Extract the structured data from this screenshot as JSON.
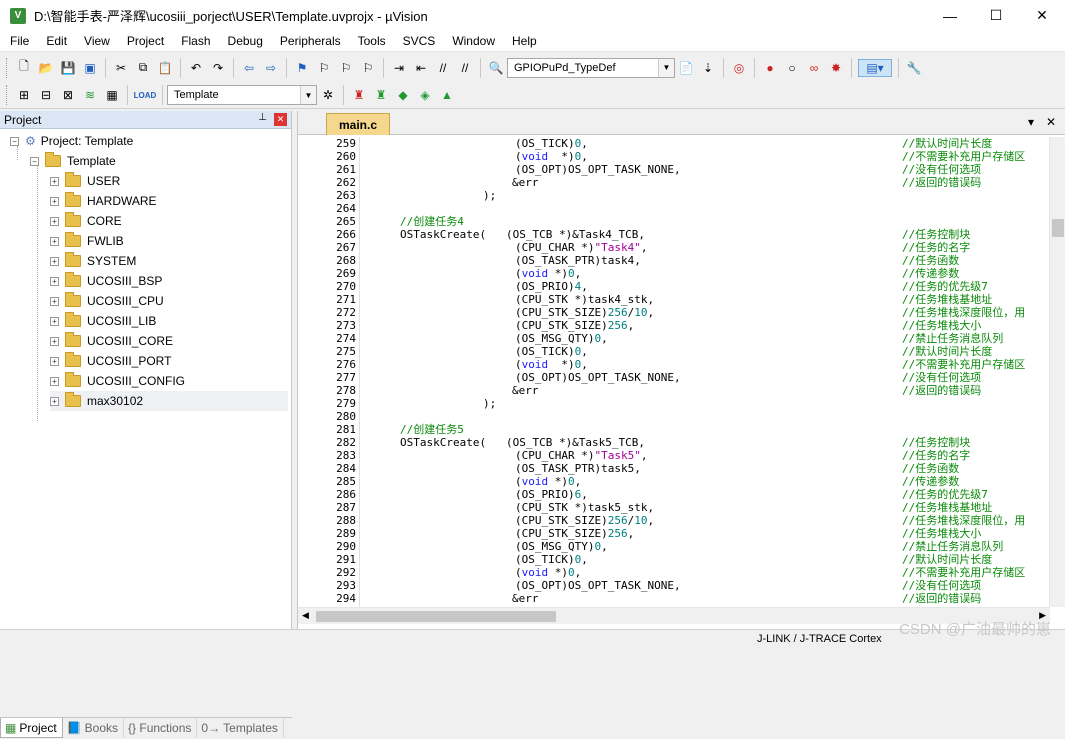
{
  "window": {
    "title": "D:\\智能手表-严泽辉\\ucosiii_porject\\USER\\Template.uvprojx - µVision",
    "app_icon": "V",
    "minimize": "—",
    "maximize": "☐",
    "close": "✕"
  },
  "menu": [
    "File",
    "Edit",
    "View",
    "Project",
    "Flash",
    "Debug",
    "Peripherals",
    "Tools",
    "SVCS",
    "Window",
    "Help"
  ],
  "toolbar1": {
    "find_combo_value": "GPIOPuPd_TypeDef"
  },
  "toolbar2": {
    "target_combo_value": "Template",
    "load_label": "LOAD"
  },
  "project_panel": {
    "title": "Project",
    "pin": "📌",
    "close": "✕",
    "root_label": "Project: Template",
    "target_label": "Template",
    "groups": [
      "USER",
      "HARDWARE",
      "CORE",
      "FWLIB",
      "SYSTEM",
      "UCOSIII_BSP",
      "UCOSIII_CPU",
      "UCOSIII_LIB",
      "UCOSIII_CORE",
      "UCOSIII_PORT",
      "UCOSIII_CONFIG",
      "max30102"
    ],
    "tabs": [
      "Project",
      "Books",
      "{} Functions",
      "0→ Templates"
    ]
  },
  "editor": {
    "file_tab": "main.c",
    "tab_menu_glyph": "▾",
    "tab_close_glyph": "✕",
    "lines": [
      {
        "n": "259",
        "code": "(OS_TICK)0,",
        "comment": "//默认时间片长度"
      },
      {
        "n": "260",
        "code": "(void  *)0,",
        "comment": "//不需要补充用户存储区"
      },
      {
        "n": "261",
        "code": "(OS_OPT)OS_OPT_TASK_NONE,",
        "comment": "//没有任何选项"
      },
      {
        "n": "262",
        "code": "&err",
        "comment": "//返回的错误码"
      },
      {
        "n": "263",
        "code": ");",
        "comment": ""
      },
      {
        "n": "264",
        "code": "",
        "comment": ""
      },
      {
        "n": "265",
        "code": "//创建任务4",
        "comment": ""
      },
      {
        "n": "266",
        "code": "OSTaskCreate(   (OS_TCB *)&Task4_TCB,",
        "comment": "//任务控制块"
      },
      {
        "n": "267",
        "code": "(CPU_CHAR *)\"Task4\",",
        "comment": "//任务的名字"
      },
      {
        "n": "268",
        "code": "(OS_TASK_PTR)task4,",
        "comment": "//任务函数"
      },
      {
        "n": "269",
        "code": "(void *)0,",
        "comment": "//传递参数"
      },
      {
        "n": "270",
        "code": "(OS_PRIO)4,",
        "comment": "//任务的优先级7"
      },
      {
        "n": "271",
        "code": "(CPU_STK *)task4_stk,",
        "comment": "//任务堆栈基地址"
      },
      {
        "n": "272",
        "code": "(CPU_STK_SIZE)256/10,",
        "comment": "//任务堆栈深度限位，用"
      },
      {
        "n": "273",
        "code": "(CPU_STK_SIZE)256,",
        "comment": "//任务堆栈大小"
      },
      {
        "n": "274",
        "code": "(OS_MSG_QTY)0,",
        "comment": "//禁止任务消息队列"
      },
      {
        "n": "275",
        "code": "(OS_TICK)0,",
        "comment": "//默认时间片长度"
      },
      {
        "n": "276",
        "code": "(void  *)0,",
        "comment": "//不需要补充用户存储区"
      },
      {
        "n": "277",
        "code": "(OS_OPT)OS_OPT_TASK_NONE,",
        "comment": "//没有任何选项"
      },
      {
        "n": "278",
        "code": "&err",
        "comment": "//返回的错误码"
      },
      {
        "n": "279",
        "code": ");",
        "comment": ""
      },
      {
        "n": "280",
        "code": "",
        "comment": ""
      },
      {
        "n": "281",
        "code": "//创建任务5",
        "comment": ""
      },
      {
        "n": "282",
        "code": "OSTaskCreate(   (OS_TCB *)&Task5_TCB,",
        "comment": "//任务控制块"
      },
      {
        "n": "283",
        "code": "(CPU_CHAR *)\"Task5\",",
        "comment": "//任务的名字"
      },
      {
        "n": "284",
        "code": "(OS_TASK_PTR)task5,",
        "comment": "//任务函数"
      },
      {
        "n": "285",
        "code": "(void *)0,",
        "comment": "//传递参数"
      },
      {
        "n": "286",
        "code": "(OS_PRIO)6,",
        "comment": "//任务的优先级7"
      },
      {
        "n": "287",
        "code": "(CPU_STK *)task5_stk,",
        "comment": "//任务堆栈基地址"
      },
      {
        "n": "288",
        "code": "(CPU_STK_SIZE)256/10,",
        "comment": "//任务堆栈深度限位，用"
      },
      {
        "n": "289",
        "code": "(CPU_STK_SIZE)256,",
        "comment": "//任务堆栈大小"
      },
      {
        "n": "290",
        "code": "(OS_MSG_QTY)0,",
        "comment": "//禁止任务消息队列"
      },
      {
        "n": "291",
        "code": "(OS_TICK)0,",
        "comment": "//默认时间片长度"
      },
      {
        "n": "292",
        "code": "(void *)0,",
        "comment": "//不需要补充用户存储区"
      },
      {
        "n": "293",
        "code": "(OS_OPT)OS_OPT_TASK_NONE,",
        "comment": "//没有任何选项"
      },
      {
        "n": "294",
        "code": "&err",
        "comment": "//返回的错误码"
      }
    ]
  },
  "status": {
    "debugger": "J-LINK / J-TRACE Cortex"
  },
  "watermark": "CSDN @广油最帅的崽"
}
